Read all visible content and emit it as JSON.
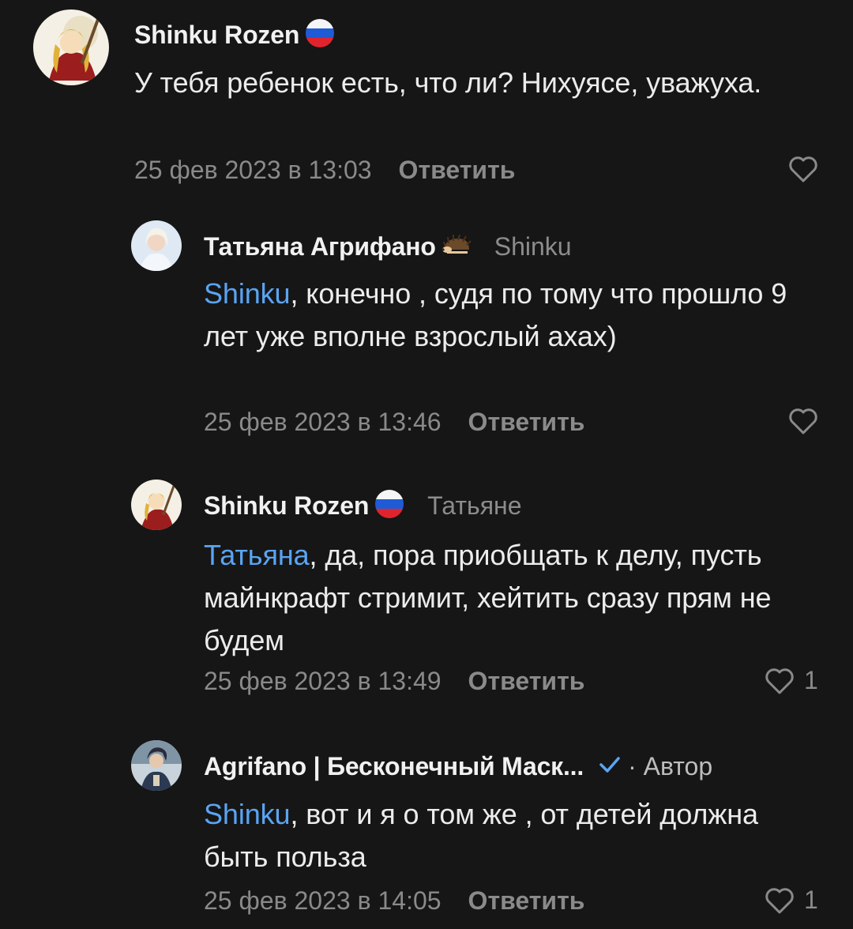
{
  "comments": [
    {
      "author": "Shinku Rozen",
      "badge": "russia-flag-icon",
      "reply_to": "",
      "mention": "",
      "text": "У тебя ребенок есть, что ли? Нихуясе, уважуха.",
      "date": "25 фев 2023 в 13:03",
      "reply_label": "Ответить",
      "likes": ""
    },
    {
      "author": "Татьяна Агрифано",
      "badge": "hedgehog-icon",
      "reply_to": "Shinku",
      "mention": "Shinku",
      "text": ", конечно , судя по тому что прошло 9 лет уже вполне взрослый ахах)",
      "date": "25 фев 2023 в 13:46",
      "reply_label": "Ответить",
      "likes": ""
    },
    {
      "author": "Shinku Rozen",
      "badge": "russia-flag-icon",
      "reply_to": "Татьяне",
      "mention": "Татьяна",
      "text": ", да, пора приобщать к делу, пусть майнкрафт стримит, хейтить сразу прям не будем",
      "date": "25 фев 2023 в 13:49",
      "reply_label": "Ответить",
      "likes": "1"
    },
    {
      "author": "Agrifano | Бесконечный Маск...",
      "badge": "verified-check-icon",
      "author_label": "· Автор",
      "reply_to": "",
      "mention": "Shinku",
      "text": ", вот и я о том же , от детей должна быть польза",
      "date": "25 фев 2023 в 14:05",
      "reply_label": "Ответить",
      "likes": "1"
    }
  ],
  "colors": {
    "background": "#161616",
    "mention": "#5aa4f3",
    "muted": "#8a8a8a",
    "verified": "#5aa4f3"
  }
}
